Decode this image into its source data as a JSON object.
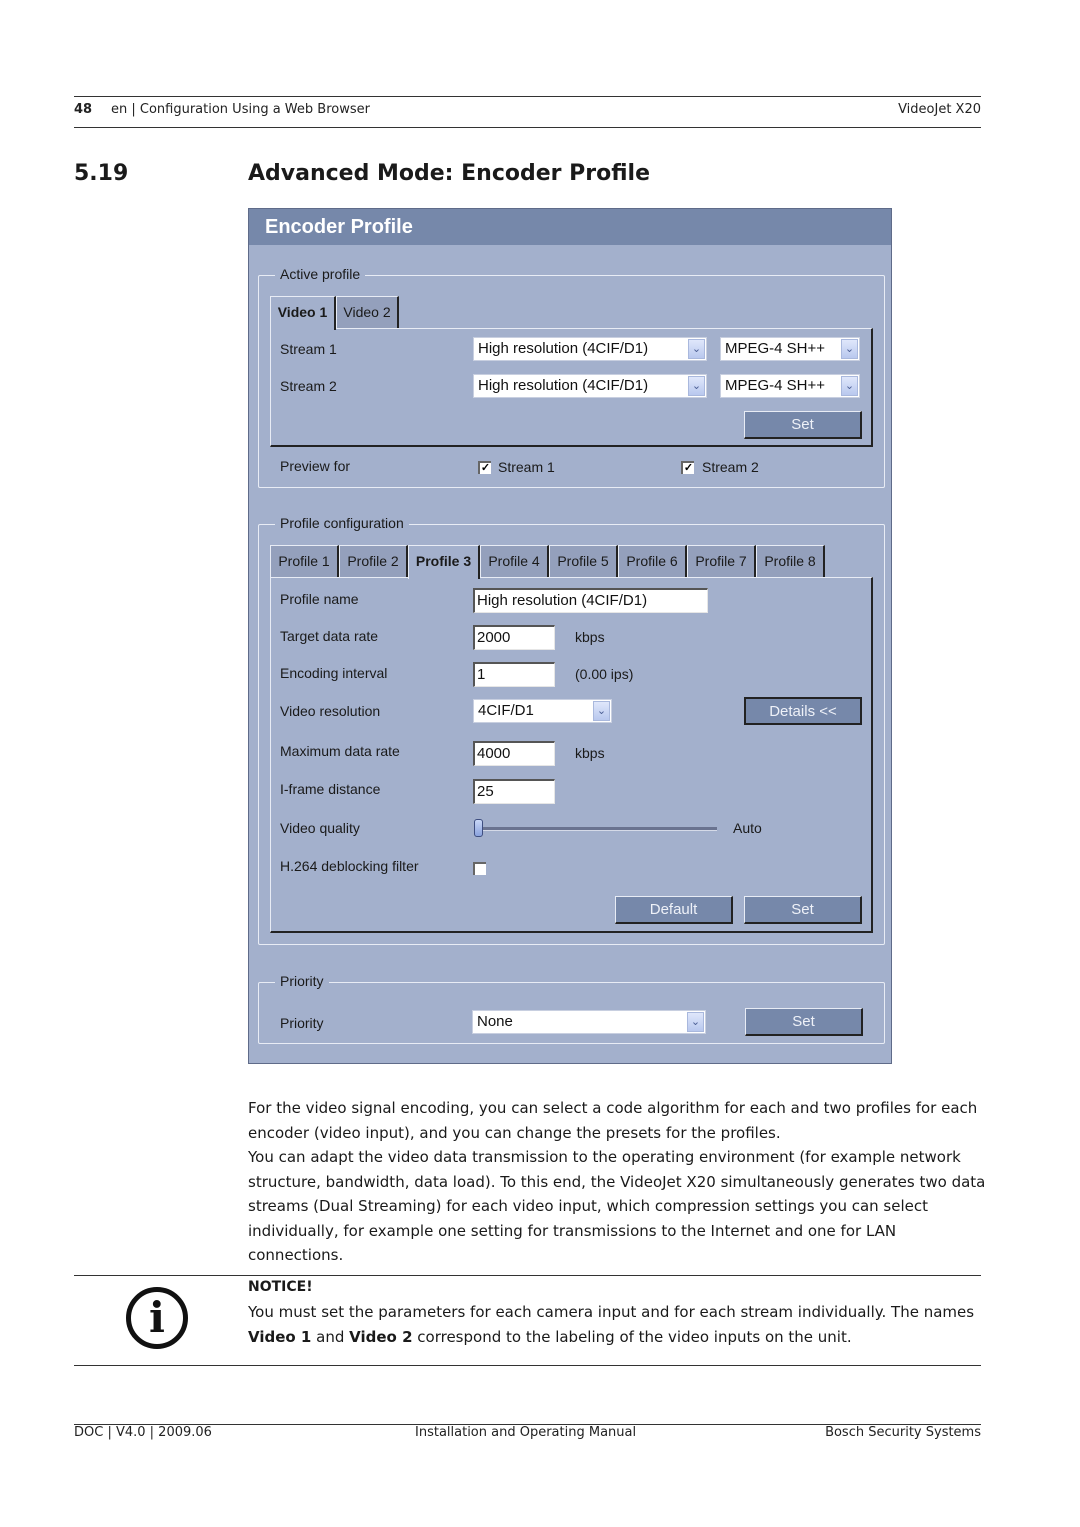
{
  "header": {
    "page_number": "48",
    "section_path": "en | Configuration Using a Web Browser",
    "product": "VideoJet X20"
  },
  "section": {
    "number": "5.19",
    "title": "Advanced Mode: Encoder Profile"
  },
  "panel": {
    "title": "Encoder Profile",
    "active_profile": {
      "legend": "Active profile",
      "tabs": [
        {
          "label": "Video 1",
          "active": true
        },
        {
          "label": "Video 2",
          "active": false
        }
      ],
      "streams": [
        {
          "label": "Stream 1",
          "profile": "High resolution (4CIF/D1)",
          "codec": "MPEG-4 SH++"
        },
        {
          "label": "Stream 2",
          "profile": "High resolution (4CIF/D1)",
          "codec": "MPEG-4 SH++"
        }
      ],
      "set_label": "Set",
      "preview_label": "Preview for",
      "preview": [
        {
          "label": "Stream 1",
          "checked": true
        },
        {
          "label": "Stream 2",
          "checked": true
        }
      ]
    },
    "profile_config": {
      "legend": "Profile configuration",
      "tabs": [
        {
          "label": "Profile 1",
          "active": false
        },
        {
          "label": "Profile 2",
          "active": false
        },
        {
          "label": "Profile 3",
          "active": true
        },
        {
          "label": "Profile 4",
          "active": false
        },
        {
          "label": "Profile 5",
          "active": false
        },
        {
          "label": "Profile 6",
          "active": false
        },
        {
          "label": "Profile 7",
          "active": false
        },
        {
          "label": "Profile 8",
          "active": false
        }
      ],
      "fields": {
        "profile_name": {
          "label": "Profile name",
          "value": "High resolution (4CIF/D1)"
        },
        "target_data_rate": {
          "label": "Target data rate",
          "value": "2000",
          "unit": "kbps"
        },
        "encoding_interval": {
          "label": "Encoding interval",
          "value": "1",
          "unit": "(0.00 ips)"
        },
        "video_resolution": {
          "label": "Video resolution",
          "value": "4CIF/D1"
        },
        "maximum_data_rate": {
          "label": "Maximum data rate",
          "value": "4000",
          "unit": "kbps"
        },
        "iframe_distance": {
          "label": "I-frame distance",
          "value": "25"
        },
        "video_quality": {
          "label": "Video quality",
          "value_text": "Auto",
          "slider_fraction": 0.0
        },
        "deblocking": {
          "label": "H.264 deblocking filter",
          "checked": false
        }
      },
      "details_label": "Details <<",
      "default_label": "Default",
      "set_label": "Set"
    },
    "priority": {
      "legend": "Priority",
      "label": "Priority",
      "value": "None",
      "set_label": "Set"
    }
  },
  "body": {
    "paragraph1": "For the video signal encoding, you can select a code algorithm for each and two profiles for each encoder (video input), and you can change the presets for the profiles.",
    "paragraph2": "You can adapt the video data transmission to the operating environment (for example network structure, bandwidth, data load). To this end, the VideoJet X20 simultaneously generates two data streams (Dual Streaming) for each video input, which compression settings you can select individually, for example one setting for transmissions to the Internet and one for LAN connections."
  },
  "notice": {
    "icon": "info-icon",
    "title": "NOTICE!",
    "text_before": "You must set the parameters for each camera input and for each stream individually. The names ",
    "bold1": "Video 1",
    "text_mid": " and ",
    "bold2": "Video 2",
    "text_after": " correspond to the labeling of the video inputs on the unit."
  },
  "footer": {
    "left": "DOC | V4.0 | 2009.06",
    "center": "Installation and Operating Manual",
    "right": "Bosch Security Systems"
  },
  "colors": {
    "panel_bg": "#a3b0cc",
    "titlebar_bg": "#7688aa",
    "button_bg": "#7688aa"
  }
}
